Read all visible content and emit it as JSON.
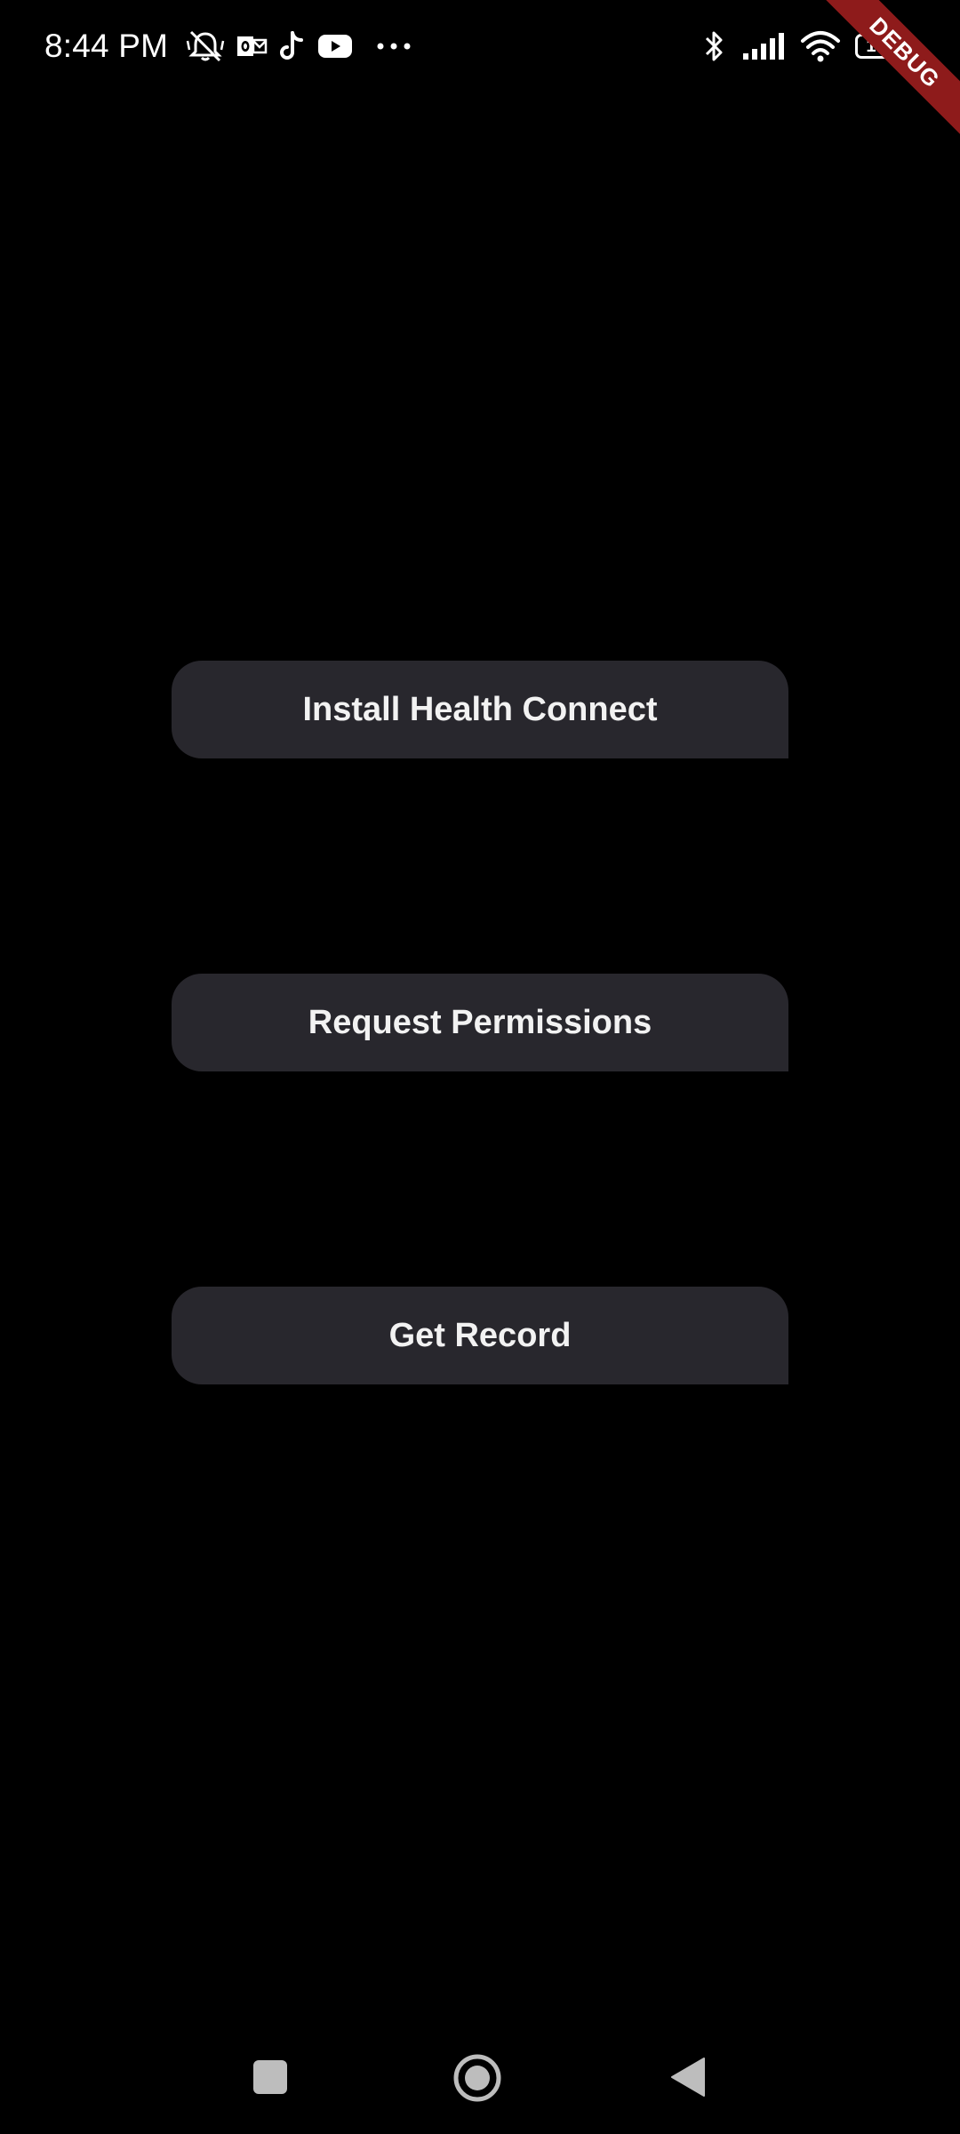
{
  "status_bar": {
    "time": "8:44 PM",
    "left_icons": [
      "muted-bell-icon",
      "outlook-icon",
      "tiktok-icon",
      "youtube-icon",
      "more-dots-icon"
    ],
    "right_icons": [
      "bluetooth-icon",
      "signal-icon",
      "wifi-icon",
      "battery-icon"
    ],
    "battery_level": "100"
  },
  "debug_banner": "DEBUG",
  "buttons": {
    "install": "Install Health Connect",
    "permissions": "Request Permissions",
    "get_record": "Get Record"
  },
  "nav_bar": {
    "items": [
      "recents",
      "home",
      "back"
    ]
  },
  "colors": {
    "background": "#000000",
    "button_bg": "#28272d",
    "button_text": "#f2f2f2",
    "debug_ribbon": "#8e1b1b"
  }
}
